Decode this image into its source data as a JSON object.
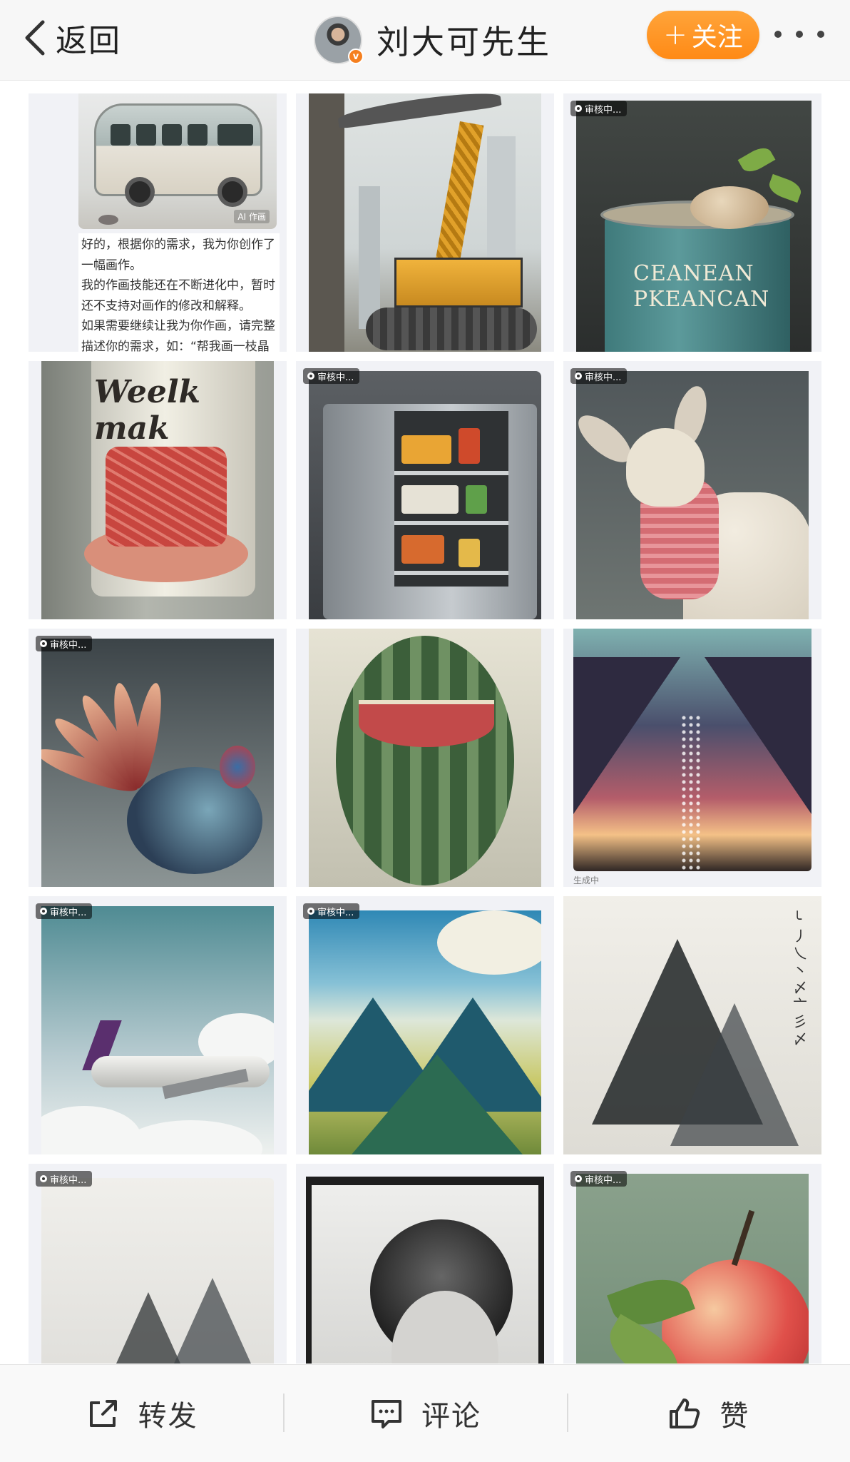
{
  "header": {
    "back_label": "返回",
    "username": "刘大可先生",
    "verified_badge": "v",
    "follow_label": "关注",
    "follow_plus": "+"
  },
  "grid": {
    "tile1_text": [
      "好的，根据你的需求，我为你创作了",
      "一幅画作。",
      "我的作画技能还在不断进化中，暂时",
      "还不支持对画作的修改和解释。",
      "如果需要继续让我为你作画，请完整",
      "描述你的需求，如：“帮我画一枝晶莹"
    ],
    "tile1_watermark": "AI 作画",
    "pending_badge": "审核中...",
    "can_label": "CEANEAN\nPKEANCAN",
    "bottle_label": "Weelk mak",
    "galaxy_caption": "生成中"
  },
  "icons": {
    "back": "chevron-left-icon",
    "more": "more-dots-icon",
    "share": "share-icon",
    "comment": "comment-icon",
    "like": "thumbs-up-icon"
  },
  "bottom_bar": {
    "share_label": "转发",
    "comment_label": "评论",
    "like_label": "赞"
  },
  "colors": {
    "follow_bg": "#ff9a2a",
    "verified": "#f57f1f",
    "header_bg": "#f7f7f7",
    "tile_bg": "#f1f2f6"
  }
}
